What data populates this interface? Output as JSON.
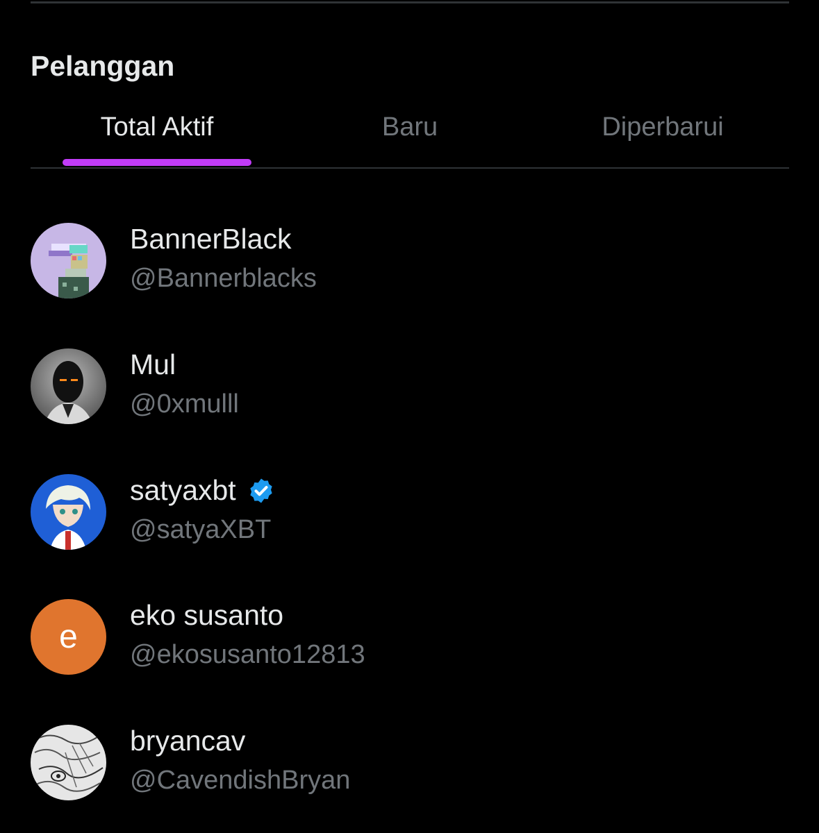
{
  "section": {
    "title": "Pelanggan"
  },
  "tabs": [
    {
      "label": "Total Aktif",
      "active": true
    },
    {
      "label": "Baru",
      "active": false
    },
    {
      "label": "Diperbarui",
      "active": false
    }
  ],
  "colors": {
    "background": "#000000",
    "accent": "#c13cf7",
    "text_primary": "#e7e9ea",
    "text_secondary": "#71767b",
    "verified": "#1d9bf0",
    "letter_avatar": "#e0752e"
  },
  "subscribers": [
    {
      "name": "BannerBlack",
      "handle": "@Bannerblacks",
      "verified": false,
      "avatar_icon": "pixel-art-avatar"
    },
    {
      "name": "Mul",
      "handle": "@0xmulll",
      "verified": false,
      "avatar_icon": "robot-avatar"
    },
    {
      "name": "satyaxbt",
      "handle": "@satyaXBT",
      "verified": true,
      "avatar_icon": "anime-avatar"
    },
    {
      "name": "eko susanto",
      "handle": "@ekosusanto12813",
      "verified": false,
      "avatar_letter": "e"
    },
    {
      "name": "bryancav",
      "handle": "@CavendishBryan",
      "verified": false,
      "avatar_icon": "sketch-avatar"
    }
  ]
}
